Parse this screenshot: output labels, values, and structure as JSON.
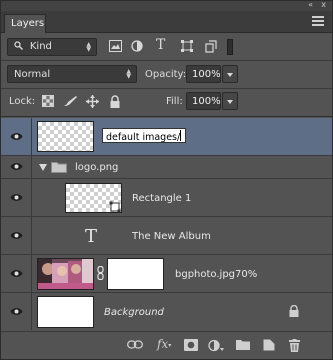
{
  "panel": {
    "tab_label": "Layers",
    "collapse_glyph": "«",
    "close_glyph": "x"
  },
  "filter": {
    "kind_label": "Kind",
    "kind_icon": "search-icon",
    "type_filter_letter": "T",
    "filter_icons": [
      "image-filter-icon",
      "adjustment-filter-icon",
      "type-filter-icon",
      "shape-filter-icon",
      "smart-object-filter-icon",
      "filter-toggle"
    ]
  },
  "blend": {
    "mode": "Normal",
    "opacity_label": "Opacity:",
    "opacity_value": "100%",
    "fill_label": "Fill:",
    "fill_value": "100%"
  },
  "lock": {
    "label": "Lock:",
    "icons": [
      "lock-transparency-icon",
      "lock-pixels-icon",
      "lock-position-icon",
      "lock-all-icon"
    ]
  },
  "layers": [
    {
      "name": "default images/",
      "kind": "editing",
      "selected": true
    },
    {
      "name": "logo.png",
      "kind": "group"
    },
    {
      "name": "Rectangle 1",
      "kind": "shape"
    },
    {
      "name": "The New Album",
      "kind": "text",
      "type_glyph": "T"
    },
    {
      "name": "bgphoto.jpg70%",
      "kind": "masked-image"
    },
    {
      "name": "Background",
      "kind": "background",
      "locked": true
    }
  ],
  "bottom_bar": {
    "fx_label": "fx",
    "icons": [
      "link-layers-icon",
      "fx-icon",
      "add-mask-icon",
      "adjustment-layer-icon",
      "new-group-icon",
      "new-layer-icon",
      "delete-icon"
    ]
  },
  "colors": {
    "panel_bg": "#535353",
    "selected_row": "#5e6e86",
    "field_bg": "#3a3a3a"
  }
}
